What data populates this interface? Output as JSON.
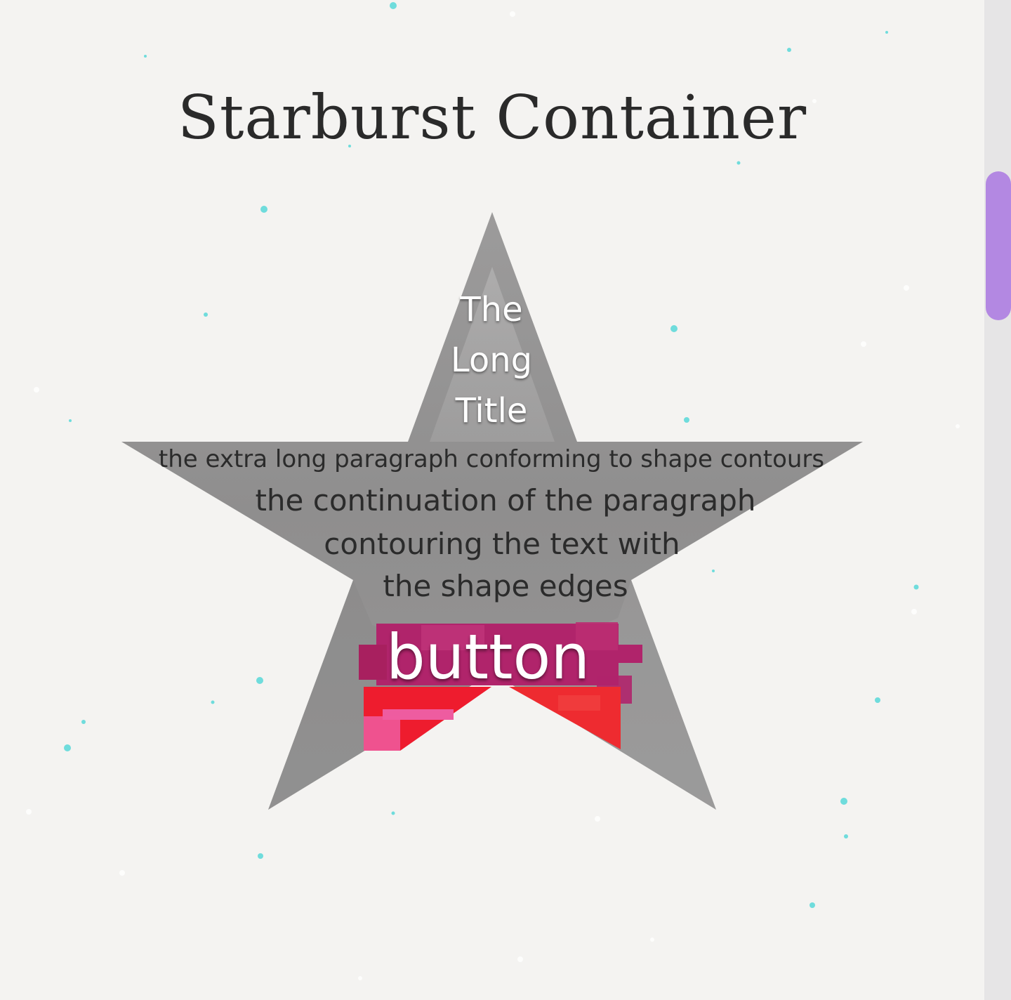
{
  "page": {
    "title": "Starburst Container"
  },
  "star_card": {
    "title_lines": [
      "The",
      "Long",
      "Title"
    ],
    "paragraph_lines": [
      "the extra long paragraph conforming to shape contours",
      "the continuation of the paragraph",
      "contouring the text with",
      "the shape edges"
    ],
    "button_label": "button"
  },
  "colors": {
    "background": "#f4f3f1",
    "star_fill": "#959494",
    "button_magenta": "#b0246b",
    "button_red": "#ee1c2e",
    "scrollbar_thumb": "#b388e2",
    "sparkle": "#57d8d6"
  }
}
